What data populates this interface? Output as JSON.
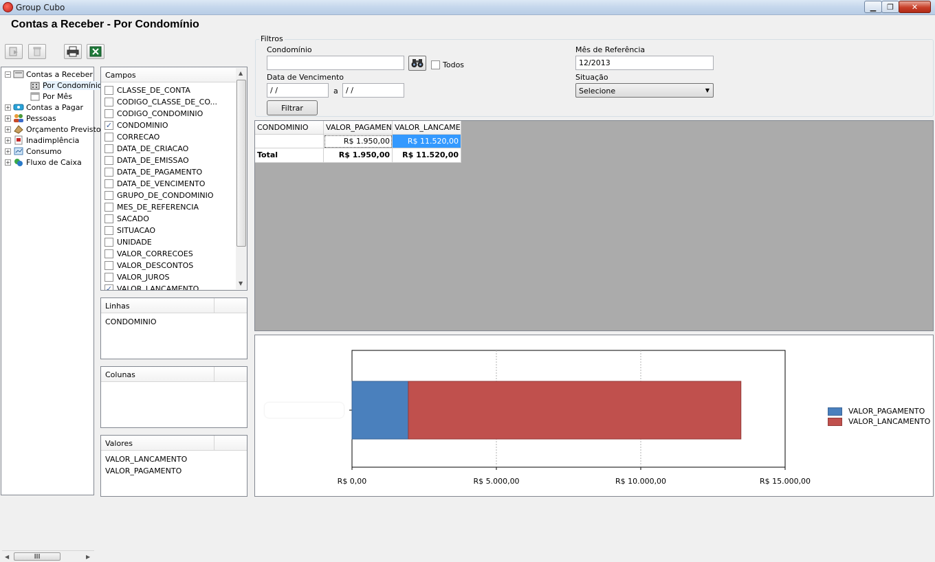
{
  "window": {
    "title": "Group Cubo"
  },
  "page": {
    "title": "Contas a Receber - Por Condomínio"
  },
  "tree": {
    "items": [
      {
        "label": "Contas a Receber",
        "expanded": true
      },
      {
        "label": "Por Condomínio",
        "selected": true
      },
      {
        "label": "Por Mês"
      },
      {
        "label": "Contas a Pagar"
      },
      {
        "label": "Pessoas"
      },
      {
        "label": "Orçamento Previsto"
      },
      {
        "label": "Inadimplência"
      },
      {
        "label": "Consumo"
      },
      {
        "label": "Fluxo de Caixa"
      }
    ],
    "scroll_label": "III"
  },
  "campos": {
    "header": "Campos",
    "items": [
      {
        "label": "CLASSE_DE_CONTA",
        "checked": false
      },
      {
        "label": "CODIGO_CLASSE_DE_CO...",
        "checked": false
      },
      {
        "label": "CODIGO_CONDOMINIO",
        "checked": false
      },
      {
        "label": "CONDOMINIO",
        "checked": true
      },
      {
        "label": "CORRECAO",
        "checked": false
      },
      {
        "label": "DATA_DE_CRIACAO",
        "checked": false
      },
      {
        "label": "DATA_DE_EMISSAO",
        "checked": false
      },
      {
        "label": "DATA_DE_PAGAMENTO",
        "checked": false
      },
      {
        "label": "DATA_DE_VENCIMENTO",
        "checked": false
      },
      {
        "label": "GRUPO_DE_CONDOMINIO",
        "checked": false
      },
      {
        "label": "MES_DE_REFERENCIA",
        "checked": false
      },
      {
        "label": "SACADO",
        "checked": false
      },
      {
        "label": "SITUACAO",
        "checked": false
      },
      {
        "label": "UNIDADE",
        "checked": false
      },
      {
        "label": "VALOR_CORRECOES",
        "checked": false
      },
      {
        "label": "VALOR_DESCONTOS",
        "checked": false
      },
      {
        "label": "VALOR_JUROS",
        "checked": false
      },
      {
        "label": "VALOR_LANCAMENTO",
        "checked": true
      }
    ]
  },
  "linhas": {
    "header": "Linhas",
    "items": [
      "CONDOMINIO"
    ]
  },
  "colunas": {
    "header": "Colunas",
    "items": []
  },
  "valores": {
    "header": "Valores",
    "items": [
      "VALOR_LANCAMENTO",
      "VALOR_PAGAMENTO"
    ]
  },
  "filtros": {
    "legend": "Filtros",
    "condominio_label": "Condomínio",
    "todos_label": "Todos",
    "vencimento_label": "Data de Vencimento",
    "venc_de": " / /",
    "a_label": "a",
    "venc_ate": " / /",
    "filtrar_label": "Filtrar",
    "mes_label": "Mês de Referência",
    "mes_value": "12/2013",
    "situacao_label": "Situação",
    "situacao_value": "Selecione"
  },
  "pivot": {
    "headers": [
      "CONDOMINIO",
      "VALOR_PAGAMEN",
      "VALOR_LANCAME"
    ],
    "row": {
      "condominio": "",
      "pagamento": "R$ 1.950,00",
      "lancamento": "R$ 11.520,00"
    },
    "total": {
      "label": "Total",
      "pagamento": "R$ 1.950,00",
      "lancamento": "R$ 11.520,00"
    }
  },
  "colors": {
    "pagamento": "#4a80bd",
    "lancamento": "#c0504d",
    "selection": "#3399ff"
  },
  "chart_data": {
    "type": "bar",
    "orientation": "horizontal",
    "stacked": true,
    "categories": [
      ""
    ],
    "series": [
      {
        "name": "VALOR_PAGAMENTO",
        "values": [
          1950
        ]
      },
      {
        "name": "VALOR_LANCAMENTO",
        "values": [
          11520
        ]
      }
    ],
    "xlim": [
      0,
      15000
    ],
    "x_ticks": [
      "R$ 0,00",
      "R$ 5.000,00",
      "R$ 10.000,00",
      "R$ 15.000,00"
    ],
    "x_tick_values": [
      0,
      5000,
      10000,
      15000
    ],
    "grid": true,
    "legend": "right"
  }
}
